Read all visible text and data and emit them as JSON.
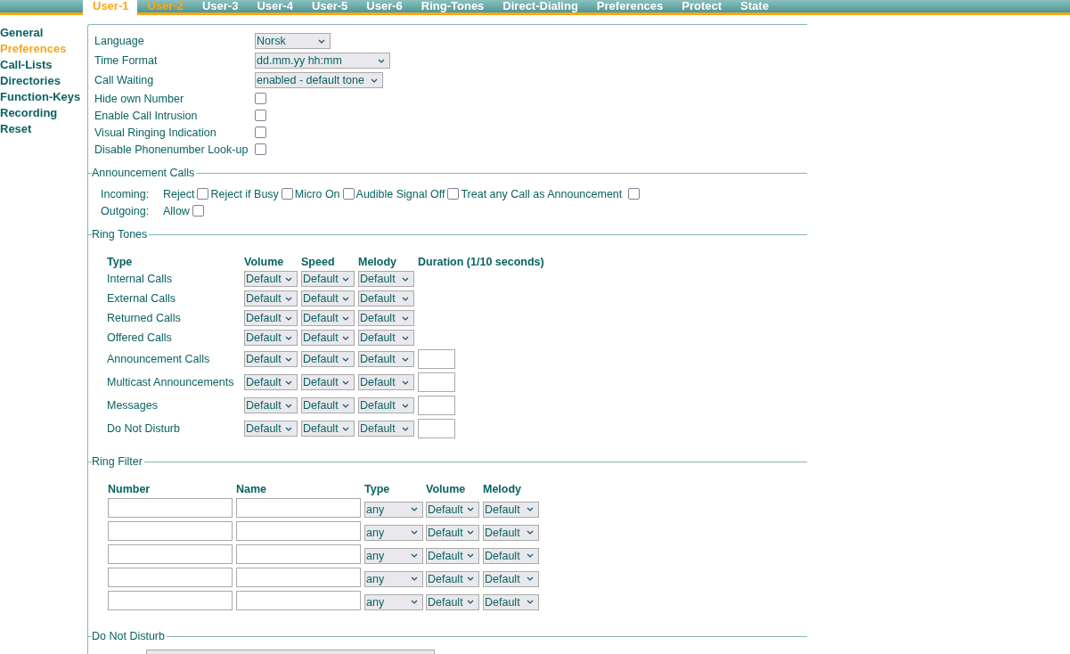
{
  "top_tabs": [
    {
      "label": "User-1",
      "selected": true,
      "highlighted": false
    },
    {
      "label": "User-2",
      "selected": false,
      "highlighted": true
    },
    {
      "label": "User-3",
      "selected": false,
      "highlighted": false
    },
    {
      "label": "User-4",
      "selected": false,
      "highlighted": false
    },
    {
      "label": "User-5",
      "selected": false,
      "highlighted": false
    },
    {
      "label": "User-6",
      "selected": false,
      "highlighted": false
    },
    {
      "label": "Ring-Tones",
      "selected": false,
      "highlighted": false
    },
    {
      "label": "Direct-Dialing",
      "selected": false,
      "highlighted": false
    },
    {
      "label": "Preferences",
      "selected": false,
      "highlighted": false
    },
    {
      "label": "Protect",
      "selected": false,
      "highlighted": false
    },
    {
      "label": "State",
      "selected": false,
      "highlighted": false
    }
  ],
  "sidebar": {
    "items": [
      {
        "label": "General",
        "selected": false
      },
      {
        "label": "Preferences",
        "selected": true
      },
      {
        "label": "Call-Lists",
        "selected": false
      },
      {
        "label": "Directories",
        "selected": false
      },
      {
        "label": "Function-Keys",
        "selected": false
      },
      {
        "label": "Recording",
        "selected": false
      },
      {
        "label": "Reset",
        "selected": false
      }
    ]
  },
  "general": [
    {
      "label": "Language",
      "kind": "select",
      "value": "Norsk"
    },
    {
      "label": "Time Format",
      "kind": "select",
      "value": "dd.mm.yy hh:mm"
    },
    {
      "label": "Call Waiting",
      "kind": "select",
      "value": "enabled - default tone"
    },
    {
      "label": "Hide own Number",
      "kind": "checkbox",
      "checked": false
    },
    {
      "label": "Enable Call Intrusion",
      "kind": "checkbox",
      "checked": false
    },
    {
      "label": "Visual Ringing Indication",
      "kind": "checkbox",
      "checked": false
    },
    {
      "label": "Disable Phonenumber Look-up",
      "kind": "checkbox",
      "checked": false
    }
  ],
  "announcement_calls": {
    "title": "Announcement Calls",
    "lines": [
      {
        "label": "Incoming:",
        "options": [
          {
            "label": "Reject",
            "checked": false
          },
          {
            "label": "Reject if Busy",
            "checked": false
          },
          {
            "label": "Micro On",
            "checked": false
          },
          {
            "label": "Audible Signal Off",
            "checked": false
          },
          {
            "label": "Treat any Call as Announcement",
            "checked": false
          }
        ]
      },
      {
        "label": "Outgoing:",
        "options": [
          {
            "label": "Allow",
            "checked": false
          }
        ]
      }
    ]
  },
  "ring_tones": {
    "title": "Ring Tones",
    "columns": [
      "Type",
      "Volume",
      "Speed",
      "Melody",
      "Duration (1/10 seconds)"
    ],
    "rows": [
      {
        "type": "Internal Calls",
        "volume": "Default",
        "speed": "Default",
        "melody": "Default",
        "kind": "basic"
      },
      {
        "type": "External Calls",
        "volume": "Default",
        "speed": "Default",
        "melody": "Default",
        "kind": "basic"
      },
      {
        "type": "Returned Calls",
        "volume": "Default",
        "speed": "Default",
        "melody": "Default",
        "kind": "basic"
      },
      {
        "type": "Offered Calls",
        "volume": "Default",
        "speed": "Default",
        "melody": "Default",
        "kind": "basic"
      },
      {
        "type": "Announcement Calls",
        "volume": "Default",
        "speed": "Default",
        "melody": "Default",
        "kind": "duration"
      },
      {
        "type": "Multicast Announcements",
        "volume": "Default",
        "speed": "Default",
        "melody": "Default",
        "kind": "duration"
      },
      {
        "type": "Messages",
        "volume": "Default",
        "speed": "Default",
        "melody": "Default",
        "kind": "duration"
      },
      {
        "type": "Do Not Disturb",
        "volume": "Default",
        "speed": "Default",
        "melody": "Default",
        "kind": "duration"
      }
    ]
  },
  "ring_filter": {
    "title": "Ring Filter",
    "columns": [
      "Number",
      "Name",
      "Type",
      "Volume",
      "Melody"
    ],
    "rows": [
      {
        "type": "any",
        "volume": "Default",
        "melody": "Default"
      },
      {
        "type": "any",
        "volume": "Default",
        "melody": "Default"
      },
      {
        "type": "any",
        "volume": "Default",
        "melody": "Default"
      },
      {
        "type": "any",
        "volume": "Default",
        "melody": "Default"
      },
      {
        "type": "any",
        "volume": "Default",
        "melody": "Default"
      }
    ]
  },
  "do_not_disturb": {
    "title": "Do Not Disturb"
  }
}
